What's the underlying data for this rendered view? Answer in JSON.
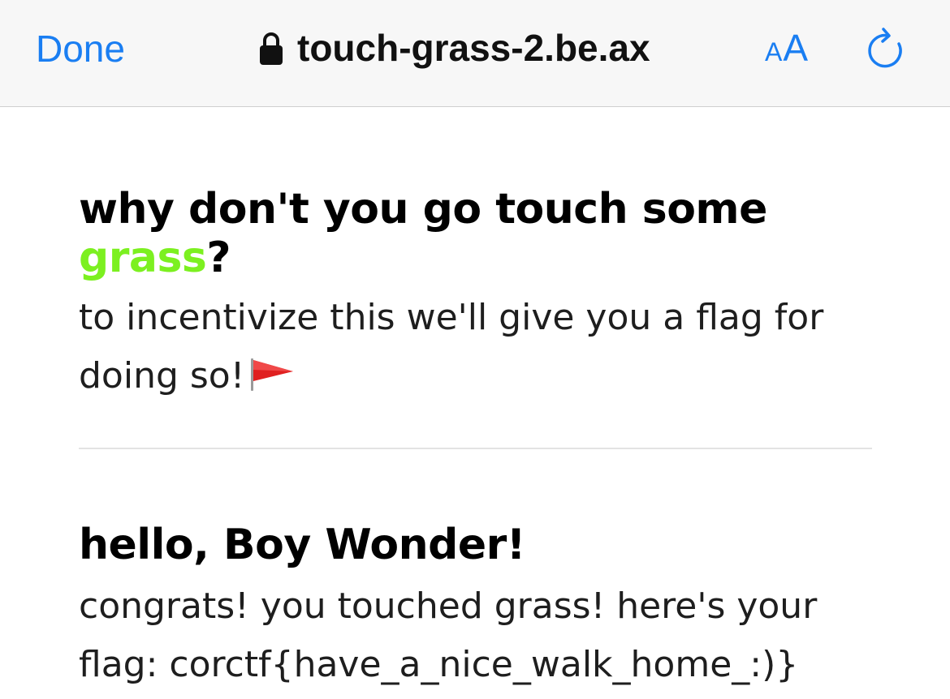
{
  "browser": {
    "done_label": "Done",
    "url": "touch-grass-2.be.ax",
    "reader_small": "A",
    "reader_big": "A",
    "lock_icon": "lock-icon",
    "reload_icon": "reload-icon",
    "accent_color": "#1a7ef2"
  },
  "page": {
    "title_prefix": "why don't you go touch some ",
    "title_highlight": "grass",
    "title_suffix": "?",
    "highlight_color": "#7cf020",
    "intro_text": "to incentivize this we'll give you a flag for doing so!",
    "flag_icon": "red-flag-icon",
    "greeting": "hello, Boy Wonder!",
    "congrats_text": "congrats! you touched grass! here's your flag: corctf{have_a_nice_walk_home_:)}"
  }
}
